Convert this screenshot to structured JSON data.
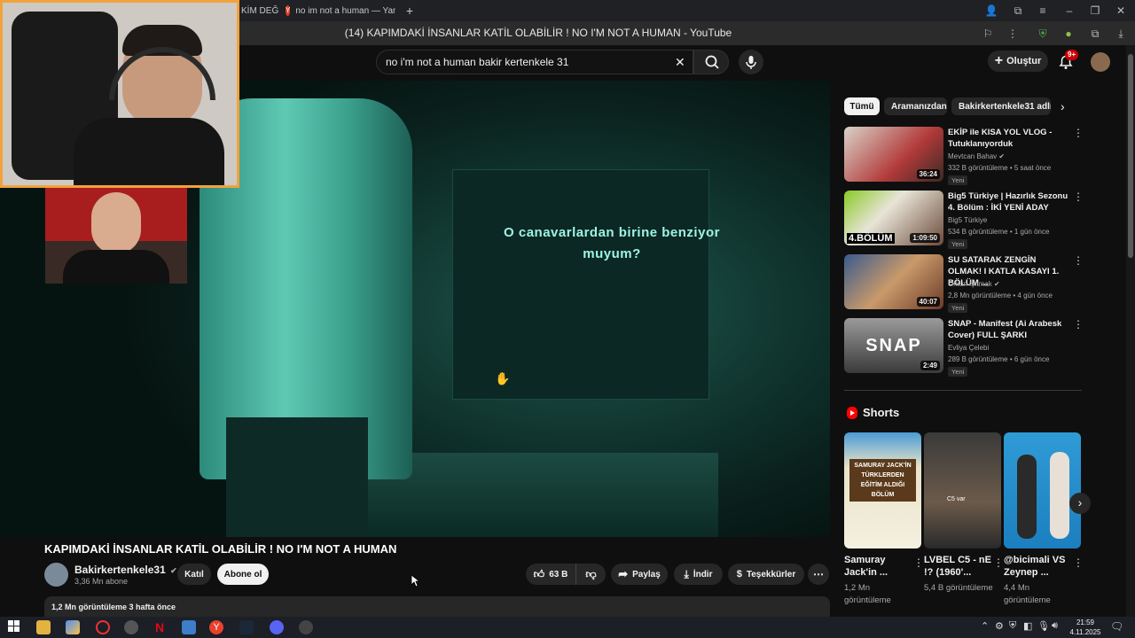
{
  "browser": {
    "tabs": [
      {
        "label": "KİM DEĞ"
      },
      {
        "label": "no im not a human — Yand"
      }
    ],
    "new_tab_label": "+",
    "page_title": "(14) KAPIMDAKİ İNSANLAR KATİL OLABİLİR ! NO I'M NOT A HUMAN - YouTube"
  },
  "header": {
    "search_value": "no i'm not a human bakir kertenkele 31",
    "create_label": "Oluştur",
    "notification_count": "9+"
  },
  "video": {
    "subtitle_line1": "O canavarlardan birine benziyor",
    "subtitle_line2": "muyum?",
    "title": "KAPIMDAKİ İNSANLAR KATİL OLABİLİR ! NO I'M NOT A HUMAN",
    "channel_name": "Bakirkertenkele31",
    "subscribers": "3,36 Mn abone",
    "join_label": "Katıl",
    "subscribe_label": "Abone ol",
    "likes": "63 B",
    "share_label": "Paylaş",
    "download_label": "İndir",
    "thanks_label": "Teşekkürler",
    "description_stats": "1,2 Mn görüntüleme  3 hafta önce"
  },
  "sidebar": {
    "chips": [
      "Tümü",
      "Aramanızdan",
      "Bakirkertenkele31 adlı yü"
    ],
    "recommendations": [
      {
        "title": "EKİP ile KISA YOL VLOG - Tutuklanıyorduk",
        "channel": "Mevtcan Bahav",
        "verified": true,
        "meta": "332 B görüntüleme • 5 saat önce",
        "badge": "Yeni",
        "duration": "36:24",
        "color": "#b23a3a"
      },
      {
        "title": "Big5 Türkiye | Hazırlık Sezonu 4. Bölüm : İKİ YENİ ADAY",
        "channel": "Big5 Türkiye",
        "verified": false,
        "meta": "534 B görüntüleme • 1 gün önce",
        "badge": "Yeni",
        "duration": "1:09:50",
        "color": "#8ac926",
        "overlay": "4.BÖLÜM"
      },
      {
        "title": "SU SATARAK ZENGİN OLMAK! I KATLA KASAYI 1. BÖLÜM ...",
        "channel": "Orkun Işıtmak",
        "verified": true,
        "meta": "2,8 Mn görüntüleme • 4 gün önce",
        "badge": "Yeni",
        "duration": "40:07",
        "color": "#3a5b8c"
      },
      {
        "title": "SNAP - Manifest (Ai Arabesk Cover) FULL ŞARKI",
        "channel": "Evliya Çelebi",
        "verified": false,
        "meta": "289 B görüntüleme • 6 gün önce",
        "badge": "Yeni",
        "duration": "2:49",
        "color": "#6b6b6b",
        "overlay": "SNAP"
      }
    ],
    "shorts_heading": "Shorts",
    "shorts": [
      {
        "title": "Samuray Jack'in ...",
        "views": "1,2 Mn görüntüleme",
        "color": "#e9e3c9",
        "overlay": "SAMURAY JACK'İN TÜRKLERDEN EĞİTİM ALDIĞI BÖLÜM"
      },
      {
        "title": "LVBEL C5 - nE !? (1960'...",
        "views": "5,4 B görüntüleme",
        "color": "#5a4a3a",
        "overlay": "C5 var"
      },
      {
        "title": "@bicimali VS Zeynep ...",
        "views": "4,4 Mn görüntüleme",
        "color": "#2f9bd6",
        "overlay": ""
      }
    ]
  },
  "taskbar": {
    "time": "21:59",
    "date": "4.11.2025"
  }
}
